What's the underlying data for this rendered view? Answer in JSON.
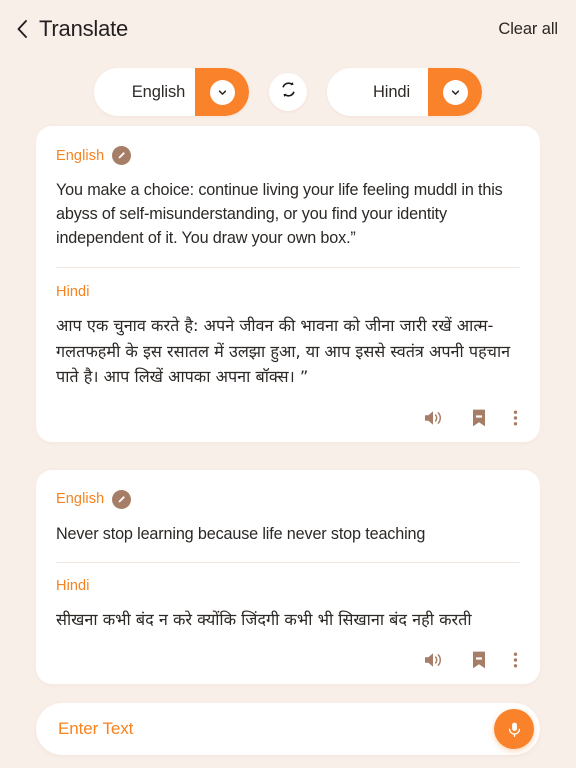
{
  "header": {
    "back_icon": "chevron-left-icon",
    "title": "Translate",
    "clear_all_label": "Clear all"
  },
  "language_selector": {
    "source": {
      "label": "English",
      "chevron_icon": "chevron-down-icon"
    },
    "swap_icon": "swap-arrows-icon",
    "target": {
      "label": "Hindi",
      "chevron_icon": "chevron-down-icon"
    },
    "accent_color": "#f9822a"
  },
  "cards": [
    {
      "source": {
        "lang_label": "English",
        "edit_icon": "pencil-edit-icon",
        "text": "You make a choice: continue living your life feeling muddl in this abyss of self-misunderstanding, or you find your identity independent of it. You draw  your own box.”"
      },
      "target": {
        "lang_label": "Hindi",
        "text": "आप एक चुनाव करते है: अपने जीवन की भावना को जीना जारी रखें आत्म-गलतफहमी के इस रसातल में उलझा हुआ, या आप इससे स्वतंत्र अपनी पहचान पाते है। आप लिखें आपका अपना बॉक्स। ”"
      },
      "actions": [
        {
          "icon": "speaker-volume-icon",
          "name": "listen-button"
        },
        {
          "icon": "bookmark-icon",
          "name": "bookmark-button"
        },
        {
          "icon": "more-vertical-icon",
          "name": "more-options-button"
        }
      ]
    },
    {
      "source": {
        "lang_label": "English",
        "edit_icon": "pencil-edit-icon",
        "text": "Never stop learning because life never stop teaching"
      },
      "target": {
        "lang_label": "Hindi",
        "text": "सीखना कभी बंद न करे क्योंकि जिंदगी कभी भी सिखाना बंद नही करती"
      },
      "actions": [
        {
          "icon": "speaker-volume-icon",
          "name": "listen-button"
        },
        {
          "icon": "bookmark-icon",
          "name": "bookmark-button"
        },
        {
          "icon": "more-vertical-icon",
          "name": "more-options-button"
        }
      ]
    }
  ],
  "input_bar": {
    "placeholder": "Enter Text",
    "value": "",
    "mic_icon": "microphone-icon"
  },
  "colors": {
    "background": "#f9efe9",
    "card": "#ffffff",
    "accent": "#f9822a",
    "accent_text": "#f7821e",
    "icon_brown": "#a67e68",
    "text": "#2c2825"
  }
}
